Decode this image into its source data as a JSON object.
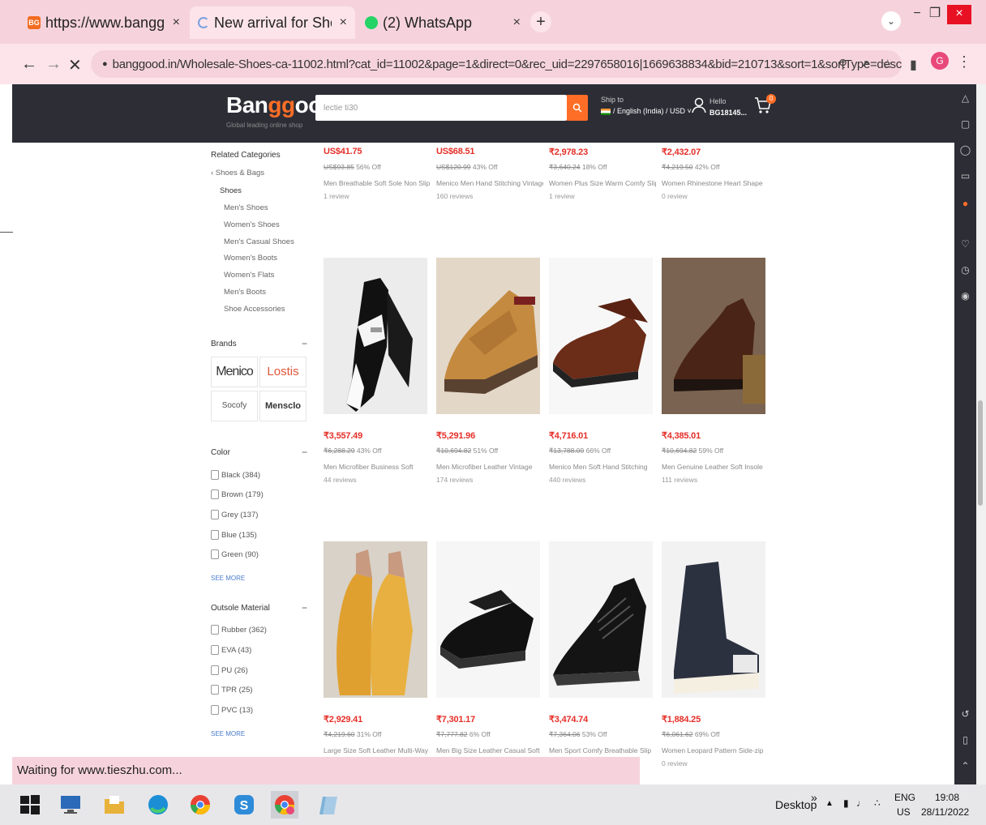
{
  "browser": {
    "tabs": [
      {
        "title": "https://www.banggood.in",
        "favicon": "BG",
        "close": "×"
      },
      {
        "title": "New arrival for Shoes on",
        "favicon": "loading",
        "close": "×"
      },
      {
        "title": "(2) WhatsApp",
        "favicon": "whatsapp",
        "close": "×"
      }
    ],
    "new_tab": "+",
    "tab_list": "⌄",
    "window_buttons": {
      "minimize": "−",
      "restore": "❐",
      "close": "×"
    },
    "back": "←",
    "forward": "→",
    "stop": "✕",
    "lock": "🔒",
    "url": "banggood.in/Wholesale-Shoes-ca-11002.html?cat_id=11002&page=1&direct=0&rec_uid=2297658016|1669638834&bid=210713&sort=1&sortType=desc",
    "profile_initial": "G",
    "menu": "⋮"
  },
  "header": {
    "logo_part1": "Ban",
    "logo_part2": "gg",
    "logo_part3": "ood",
    "logo_tagline": "Global leading online shop",
    "search_value": "lectie ti30",
    "search_icon": "search-icon",
    "ship_to": "Ship to",
    "locale": "/ English (India) / USD",
    "hello": "Hello",
    "user_id": "BG18145...",
    "cart_count": "0"
  },
  "sidebar": {
    "related_title": "Related Categories",
    "parent_link": "‹ Shoes & Bags",
    "current": "Shoes",
    "categories": [
      "Men's Shoes",
      "Women's Shoes",
      "Men's Casual Shoes",
      "Women's Boots",
      "Women's Flats",
      "Men's Boots",
      "Shoe Accessories"
    ],
    "brands_title": "Brands",
    "brands": [
      "Menico",
      "Lostis",
      "Socofy",
      "Mensclo"
    ],
    "color_title": "Color",
    "colors": [
      "Black (384)",
      "Brown (179)",
      "Grey (137)",
      "Blue (135)",
      "Green (90)"
    ],
    "see_more": "SEE MORE",
    "outsole_title": "Outsole Material",
    "outsoles": [
      "Rubber (362)",
      "EVA (43)",
      "PU (26)",
      "TPR (25)",
      "PVC (13)"
    ],
    "collapse": "−"
  },
  "products_row0": [
    {
      "price": "US$41.75",
      "orig": "US$93.85",
      "off": "56% Off",
      "name": "Men Breathable Soft Sole Non Slip",
      "reviews": "1 review"
    },
    {
      "price": "US$68.51",
      "orig": "US$120.99",
      "off": "43% Off",
      "name": "Menico Men Hand Stitching Vintage",
      "reviews": "160 reviews"
    },
    {
      "price": "₹2,978.23",
      "orig": "₹3,640.24",
      "off": "18% Off",
      "name": "Women Plus Size Warm Comfy Slip",
      "reviews": "1 review"
    },
    {
      "price": "₹2,432.07",
      "orig": "₹4,219.50",
      "off": "42% Off",
      "name": "Women Rhinestone Heart Shape",
      "reviews": "0 review"
    }
  ],
  "products_row1": [
    {
      "price": "₹3,557.49",
      "orig": "₹6,288.29",
      "off": "43% Off",
      "name": "Men Microfiber Business Soft",
      "reviews": "44 reviews"
    },
    {
      "price": "₹5,291.96",
      "orig": "₹10,694.82",
      "off": "51% Off",
      "name": "Men Microfiber Leather Vintage",
      "reviews": "174 reviews"
    },
    {
      "price": "₹4,716.01",
      "orig": "₹13,788.09",
      "off": "66% Off",
      "name": "Menico Men Soft Hand Stitching",
      "reviews": "440 reviews"
    },
    {
      "price": "₹4,385.01",
      "orig": "₹10,694.82",
      "off": "59% Off",
      "name": "Men Genuine Leather Soft Insole",
      "reviews": "111 reviews"
    }
  ],
  "products_row2": [
    {
      "price": "₹2,929.41",
      "orig": "₹4,219.60",
      "off": "31% Off",
      "name": "Large Size Soft Leather Multi-Way",
      "reviews": ""
    },
    {
      "price": "₹7,301.17",
      "orig": "₹7,777.82",
      "off": "6% Off",
      "name": "Men Big Size Leather Casual Soft",
      "reviews": ""
    },
    {
      "price": "₹3,474.74",
      "orig": "₹7,364.06",
      "off": "53% Off",
      "name": "Men Sport Comfy Breathable Slip",
      "reviews": ""
    },
    {
      "price": "₹1,884.25",
      "orig": "₹6,061.62",
      "off": "69% Off",
      "name": "Women Leopard Pattern Side-zip",
      "reviews": "0 review"
    }
  ],
  "status_text": "Waiting for www.tieszhu.com...",
  "taskbar": {
    "desktop_label": "Desktop",
    "chevron": "»",
    "lang": "ENG",
    "region": "US",
    "time": "19:08",
    "date": "28/11/2022"
  },
  "colors": {
    "accent": "#ff6e26",
    "header_bg": "#2d2d36",
    "price_red": "#e52f28",
    "chrome_pink": "#f6d3dc"
  }
}
